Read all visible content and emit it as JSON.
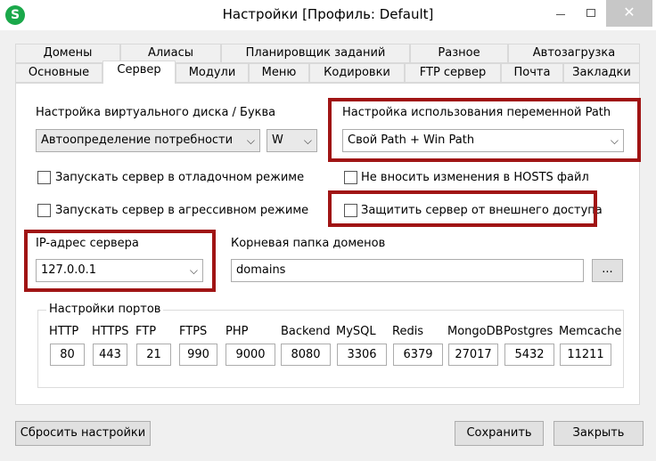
{
  "window": {
    "title": "Настройки [Профиль: Default]",
    "app_icon_letter": "S",
    "close_glyph": "✕"
  },
  "tabs_row1": [
    "Домены",
    "Алиасы",
    "Планировщик заданий",
    "Разное",
    "Автозагрузка"
  ],
  "tabs_row2": [
    "Основные",
    "Сервер",
    "Модули",
    "Меню",
    "Кодировки",
    "FTP сервер",
    "Почта",
    "Закладки"
  ],
  "active_tab": "Сервер",
  "server": {
    "virtual_disk_label": "Настройка виртуального диска / Буква",
    "virtual_disk_value": "Автоопределение потребности",
    "drive_letter_value": "W",
    "path_label": "Настройка использования переменной Path",
    "path_value": "Свой Path + Win Path",
    "debug_mode_label": "Запускать сервер в отладочном режиме",
    "debug_mode_checked": false,
    "aggressive_mode_label": "Запускать сервер в агрессивном режиме",
    "aggressive_mode_checked": false,
    "no_hosts_label": "Не вносить изменения в HOSTS файл",
    "no_hosts_checked": false,
    "protect_label": "Защитить сервер от внешнего доступа",
    "protect_checked": false,
    "ip_label": "IP-адрес сервера",
    "ip_value": "127.0.0.1",
    "root_label": "Корневая папка доменов",
    "root_value": "domains",
    "browse_label": "...",
    "ports_group_label": "Настройки портов",
    "ports": [
      {
        "name": "HTTP",
        "value": "80"
      },
      {
        "name": "HTTPS",
        "value": "443"
      },
      {
        "name": "FTP",
        "value": "21"
      },
      {
        "name": "FTPS",
        "value": "990"
      },
      {
        "name": "PHP",
        "value": "9000"
      },
      {
        "name": "Backend",
        "value": "8080"
      },
      {
        "name": "MySQL",
        "value": "3306"
      },
      {
        "name": "Redis",
        "value": "6379"
      },
      {
        "name": "MongoDB",
        "value": "27017"
      },
      {
        "name": "Postgres",
        "value": "5432"
      },
      {
        "name": "Memcache",
        "value": "11211"
      }
    ]
  },
  "footer": {
    "reset_label": "Сбросить настройки",
    "save_label": "Сохранить",
    "close_label": "Закрыть"
  },
  "colors": {
    "highlight": "#a01414",
    "app_icon": "#1aa84a"
  }
}
